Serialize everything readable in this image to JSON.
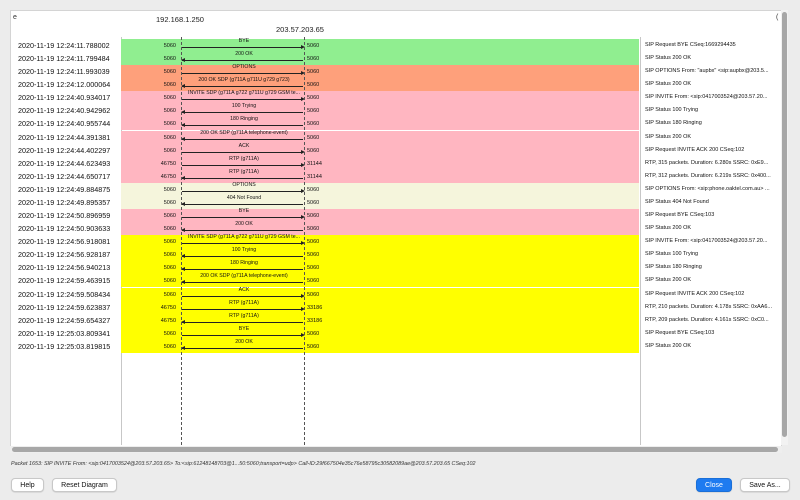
{
  "header": {
    "host_left": "192.168.1.250",
    "host_right": "203.57.203.65",
    "edge_left": "e",
    "edge_right": "("
  },
  "colors": {
    "green": "#90ee90",
    "salmon": "#fea07b",
    "pink": "#ffb6c1",
    "cream": "#f5f5dc",
    "yellow": "#ffff00"
  },
  "flows": [
    {
      "time": "2020-11-19 12:24:11.788002",
      "lport": "5060",
      "rport": "5060",
      "label": "BYE",
      "dir": "right",
      "color": "green",
      "comment": "SIP Request BYE CSeq:1669294435"
    },
    {
      "time": "2020-11-19 12:24:11.799484",
      "lport": "5060",
      "rport": "5060",
      "label": "200 OK",
      "dir": "left",
      "color": "green",
      "comment": "SIP Status 200 OK"
    },
    {
      "time": "2020-11-19 12:24:11.993039",
      "lport": "5060",
      "rport": "5060",
      "label": "OPTIONS",
      "dir": "right",
      "color": "salmon",
      "comment": "SIP OPTIONS From: \"aupbx\" <sip:aupbx@203.5..."
    },
    {
      "time": "2020-11-19 12:24:12.000064",
      "lport": "5060",
      "rport": "5060",
      "label": "200 OK SDP (g711A g711U g729 g723)",
      "dir": "left",
      "color": "salmon",
      "comment": "SIP Status 200 OK"
    },
    {
      "time": "2020-11-19 12:24:40.934017",
      "lport": "5060",
      "rport": "5060",
      "label": "INVITE SDP (g711A g722 g711U g729 GSM te...",
      "dir": "right",
      "color": "pink",
      "comment": "SIP INVITE From: <sip:0417003524@203.57.20..."
    },
    {
      "time": "2020-11-19 12:24:40.942962",
      "lport": "5060",
      "rport": "5060",
      "label": "100 Trying",
      "dir": "left",
      "color": "pink",
      "comment": "SIP Status 100 Trying"
    },
    {
      "time": "2020-11-19 12:24:40.955744",
      "lport": "5060",
      "rport": "5060",
      "label": "180 Ringing",
      "dir": "left",
      "color": "pink",
      "comment": "SIP Status 180 Ringing"
    },
    {
      "time": "2020-11-19 12:24:44.391381",
      "lport": "5060",
      "rport": "5060",
      "label": "200 OK SDP (g711A telephone-event)",
      "dir": "left",
      "color": "pink",
      "comment": "SIP Status 200 OK"
    },
    {
      "time": "2020-11-19 12:24:44.402297",
      "lport": "5060",
      "rport": "5060",
      "label": "ACK",
      "dir": "right",
      "color": "pink",
      "comment": "SIP Request INVITE ACK 200 CSeq:102"
    },
    {
      "time": "2020-11-19 12:24:44.623493",
      "lport": "46750",
      "rport": "31144",
      "label": "RTP (g711A)",
      "dir": "right",
      "color": "pink",
      "comment": "RTP, 315 packets. Duration: 6.280s SSRC: 0xE9..."
    },
    {
      "time": "2020-11-19 12:24:44.650717",
      "lport": "46750",
      "rport": "31144",
      "label": "RTP (g711A)",
      "dir": "left",
      "color": "pink",
      "comment": "RTP, 312 packets. Duration: 6.219s SSRC: 0x400..."
    },
    {
      "time": "2020-11-19 12:24:49.884875",
      "lport": "5060",
      "rport": "5060",
      "label": "OPTIONS",
      "dir": "right",
      "color": "cream",
      "comment": "SIP OPTIONS From: <sip:phone.oaktel.com.au> ..."
    },
    {
      "time": "2020-11-19 12:24:49.895357",
      "lport": "5060",
      "rport": "5060",
      "label": "404 Not Found",
      "dir": "left",
      "color": "cream",
      "comment": "SIP Status 404 Not Found"
    },
    {
      "time": "2020-11-19 12:24:50.896959",
      "lport": "5060",
      "rport": "5060",
      "label": "BYE",
      "dir": "right",
      "color": "pink",
      "comment": "SIP Request BYE CSeq:103"
    },
    {
      "time": "2020-11-19 12:24:50.903633",
      "lport": "5060",
      "rport": "5060",
      "label": "200 OK",
      "dir": "left",
      "color": "pink",
      "comment": "SIP Status 200 OK"
    },
    {
      "time": "2020-11-19 12:24:56.918081",
      "lport": "5060",
      "rport": "5060",
      "label": "INVITE SDP (g711A g722 g711U g729 GSM te...",
      "dir": "right",
      "color": "yellow",
      "comment": "SIP INVITE From: <sip:0417003524@203.57.20..."
    },
    {
      "time": "2020-11-19 12:24:56.928187",
      "lport": "5060",
      "rport": "5060",
      "label": "100 Trying",
      "dir": "left",
      "color": "yellow",
      "comment": "SIP Status 100 Trying"
    },
    {
      "time": "2020-11-19 12:24:56.940213",
      "lport": "5060",
      "rport": "5060",
      "label": "180 Ringing",
      "dir": "left",
      "color": "yellow",
      "comment": "SIP Status 180 Ringing"
    },
    {
      "time": "2020-11-19 12:24:59.463915",
      "lport": "5060",
      "rport": "5060",
      "label": "200 OK SDP (g711A telephone-event)",
      "dir": "left",
      "color": "yellow",
      "comment": "SIP Status 200 OK"
    },
    {
      "time": "2020-11-19 12:24:59.508434",
      "lport": "5060",
      "rport": "5060",
      "label": "ACK",
      "dir": "right",
      "color": "yellow",
      "comment": "SIP Request INVITE ACK 200 CSeq:102"
    },
    {
      "time": "2020-11-19 12:24:59.623837",
      "lport": "46750",
      "rport": "33186",
      "label": "RTP (g711A)",
      "dir": "right",
      "color": "yellow",
      "comment": "RTP, 210 packets. Duration: 4.178s SSRC: 0xAA6..."
    },
    {
      "time": "2020-11-19 12:24:59.654327",
      "lport": "46750",
      "rport": "33186",
      "label": "RTP (g711A)",
      "dir": "left",
      "color": "yellow",
      "comment": "RTP, 209 packets. Duration: 4.161s SSRC: 0xC0..."
    },
    {
      "time": "2020-11-19 12:25:03.809341",
      "lport": "5060",
      "rport": "5060",
      "label": "BYE",
      "dir": "right",
      "color": "yellow",
      "comment": "SIP Request BYE CSeq:103"
    },
    {
      "time": "2020-11-19 12:25:03.819815",
      "lport": "5060",
      "rport": "5060",
      "label": "200 OK",
      "dir": "left",
      "color": "yellow",
      "comment": "SIP Status 200 OK"
    }
  ],
  "status_bar": "Packet 1653: SIP INVITE From: <sip:0417003524@203.57.203.65> To:<sip:61248148703@1...50:5060;transport=udp> Call-ID:29f667504e35c76e58795c30582089ae@203.57.203.65 CSeq:102",
  "buttons": {
    "help": "Help",
    "reset": "Reset Diagram",
    "close": "Close",
    "save_as": "Save As..."
  }
}
